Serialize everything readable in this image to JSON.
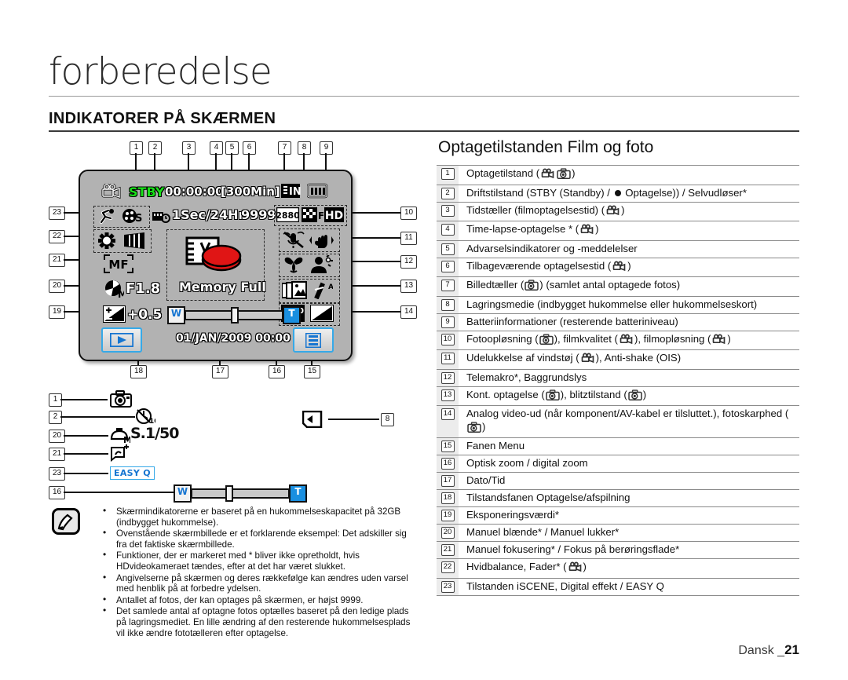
{
  "header": {
    "chapter_title": "forberedelse",
    "section_title": "INDIKATORER PÅ SKÆRMEN"
  },
  "lcd": {
    "top_callouts": [
      "1",
      "2",
      "3",
      "4",
      "5",
      "6",
      "7",
      "8",
      "9"
    ],
    "left_callouts": [
      "23",
      "22",
      "21",
      "20",
      "19"
    ],
    "right_callouts": [
      "10",
      "11",
      "12",
      "13",
      "14"
    ],
    "bottom_callouts": [
      "18",
      "17",
      "16",
      "15"
    ],
    "mode_icon": "camcorder-icon",
    "status_text": "STBY",
    "time_counter": "00:00:00",
    "remaining_time": "[300Min]",
    "storage_icon": "memory-internal-icon",
    "battery_icon": "battery-icon",
    "row2": {
      "iscene_icon": "iscene-sports-icon",
      "digital_effect_icon": "digital-effect-icon",
      "timelapse_icon": "timelapse-icon",
      "timelapse_text": "1Sec/24Hr",
      "photo_counter": "9999",
      "photo_res": "2880",
      "movie_quality_icon": "fine-quality-icon",
      "movie_res": "HD"
    },
    "row3": {
      "white_balance_icon": "white-balance-sun-icon",
      "fader_icon": "fader-icon",
      "wind_cut_icon": "wind-cut-icon",
      "anti_shake_icon": "anti-shake-ois-icon"
    },
    "row4": {
      "focus_text": "MF",
      "tele_macro_icon": "tele-macro-icon",
      "backlight_icon": "backlight-icon"
    },
    "row5": {
      "aperture_icon": "manual-aperture-icon",
      "aperture_text": "F1.8",
      "cont_shot_icon": "continuous-shot-icon",
      "flash_icon": "flash-auto-icon"
    },
    "row6": {
      "exposure_icon": "exposure-icon",
      "exposure_text": "+0.5",
      "video_out_icon": "1080-hd-out-icon",
      "sharpness_icon": "photo-sharpness-icon"
    },
    "warning_icon": "memory-full-icon",
    "warning_text": "Memory Full",
    "zoom": {
      "wide_label": "W",
      "tele_label": "T"
    },
    "play_tab_icon": "play-tab-icon",
    "datetime": "01/JAN/2009 00:00",
    "menu_tab_icon": "menu-tab-icon"
  },
  "photo_diagram": {
    "rows": [
      {
        "num": "1",
        "icon": "photo-mode-camera-icon",
        "text": ""
      },
      {
        "num": "2",
        "icon": "self-timer-icon",
        "text": ""
      },
      {
        "num": "20",
        "icon": "manual-shutter-icon",
        "text": "S.1/50"
      },
      {
        "num": "21",
        "icon": "touch-point-focus-icon",
        "text": ""
      },
      {
        "num": "23",
        "icon": "easyq-badge",
        "text": "EASY Q"
      },
      {
        "num": "16",
        "icon": "zoom-bar",
        "text": ""
      }
    ],
    "side_callout": {
      "num": "8",
      "icon": "memory-card-icon"
    }
  },
  "notes": {
    "icon": "note-pen-icon",
    "items": [
      "Skærmindikatorerne er baseret på en hukommelseskapacitet på 32GB (indbygget hukommelse).",
      "Ovenstående skærmbillede er et forklarende eksempel: Det adskiller sig fra det faktiske skærmbillede.",
      "Funktioner, der er markeret med * bliver ikke opretholdt, hvis HDvideokameraet tændes, efter at det har været slukket.",
      "Angivelserne på skærmen og deres rækkefølge kan ændres uden varsel med henblik på at forbedre ydelsen.",
      "Antallet af fotos, der kan optages på skærmen, er højst 9999.",
      "Det samlede antal af optagne fotos optælles baseret på den ledige plads på lagringsmediet. En lille ændring    af den resterende hukommelsesplads vil ikke ændre fototælleren efter optagelse."
    ]
  },
  "right_panel": {
    "heading": "Optagetilstanden Film og foto",
    "items": [
      {
        "num": "1",
        "pre": "Optagetilstand (",
        "icons": [
          "camcorder-small-icon",
          "camera-small-icon"
        ],
        "post": ")"
      },
      {
        "num": "2",
        "pre": "Driftstilstand (STBY (Standby) / ",
        "icons": [
          "black-dot"
        ],
        "post": " Optagelse)) / Selvudløser*"
      },
      {
        "num": "3",
        "pre": "Tidstæller (filmoptagelsestid) (",
        "icons": [
          "camcorder-small-icon"
        ],
        "post": ")"
      },
      {
        "num": "4",
        "pre": "Time-lapse-optagelse * (",
        "icons": [
          "camcorder-small-icon"
        ],
        "post": ")"
      },
      {
        "num": "5",
        "pre": "Advarselsindikatorer og -meddelelser",
        "icons": [],
        "post": ""
      },
      {
        "num": "6",
        "pre": "Tilbageværende optagelsestid (",
        "icons": [
          "camcorder-small-icon"
        ],
        "post": ")"
      },
      {
        "num": "7",
        "pre": "Billedtæller (",
        "icons": [
          "camera-small-icon"
        ],
        "post": ") (samlet antal optagede fotos)"
      },
      {
        "num": "8",
        "pre": "Lagringsmedie (indbygget hukommelse eller hukommelseskort)",
        "icons": [],
        "post": ""
      },
      {
        "num": "9",
        "pre": "Batteriinformationer (resterende batteriniveau)",
        "icons": [],
        "post": ""
      },
      {
        "num": "10",
        "pre": "Fotoopløsning (",
        "icons": [
          "camera-small-icon"
        ],
        "mid": "), filmkvalitet (",
        "icons2": [
          "camcorder-small-icon"
        ],
        "mid2": "), filmopløsning (",
        "icons3": [
          "camcorder-small-icon"
        ],
        "post": ")"
      },
      {
        "num": "11",
        "pre": "Udelukkelse af vindstøj (",
        "icons": [
          "camcorder-small-icon"
        ],
        "post": "), Anti-shake (OIS)"
      },
      {
        "num": "12",
        "pre": "Telemakro*, Baggrundslys",
        "icons": [],
        "post": ""
      },
      {
        "num": "13",
        "pre": "Kont. optagelse (",
        "icons": [
          "camera-small-icon"
        ],
        "mid": "), blitztilstand (",
        "icons2": [
          "camera-small-icon"
        ],
        "post": ")"
      },
      {
        "num": "14",
        "pre": "Analog video-ud (når komponent/AV-kabel er tilsluttet.), fotoskarphed (",
        "icons": [
          "camera-small-icon"
        ],
        "post": ")"
      },
      {
        "num": "15",
        "pre": "Fanen Menu",
        "icons": [],
        "post": ""
      },
      {
        "num": "16",
        "pre": "Optisk zoom / digital zoom",
        "icons": [],
        "post": ""
      },
      {
        "num": "17",
        "pre": "Dato/Tid",
        "icons": [],
        "post": ""
      },
      {
        "num": "18",
        "pre": "Tilstandsfanen Optagelse/afspilning",
        "icons": [],
        "post": ""
      },
      {
        "num": "19",
        "pre": "Eksponeringsværdi*",
        "icons": [],
        "post": ""
      },
      {
        "num": "20",
        "pre": "Manuel blænde* / Manuel lukker*",
        "icons": [],
        "post": ""
      },
      {
        "num": "21",
        "pre": "Manuel fokusering* / Fokus på berøringsflade*",
        "icons": [],
        "post": ""
      },
      {
        "num": "22",
        "pre": "Hvidbalance, Fader* (",
        "icons": [
          "camcorder-small-icon"
        ],
        "post": ")"
      },
      {
        "num": "23",
        "pre": "Tilstanden iSCENE, Digital effekt / EASY Q",
        "icons": [],
        "post": ""
      }
    ]
  },
  "footer": {
    "language": "Dansk _",
    "page": "21"
  },
  "colors": {
    "lcd_background": "#b2b2b2",
    "status_green": "#19e019",
    "accent_blue": "#36a9e8",
    "warning_red": "#e01515",
    "text": "#111111"
  }
}
